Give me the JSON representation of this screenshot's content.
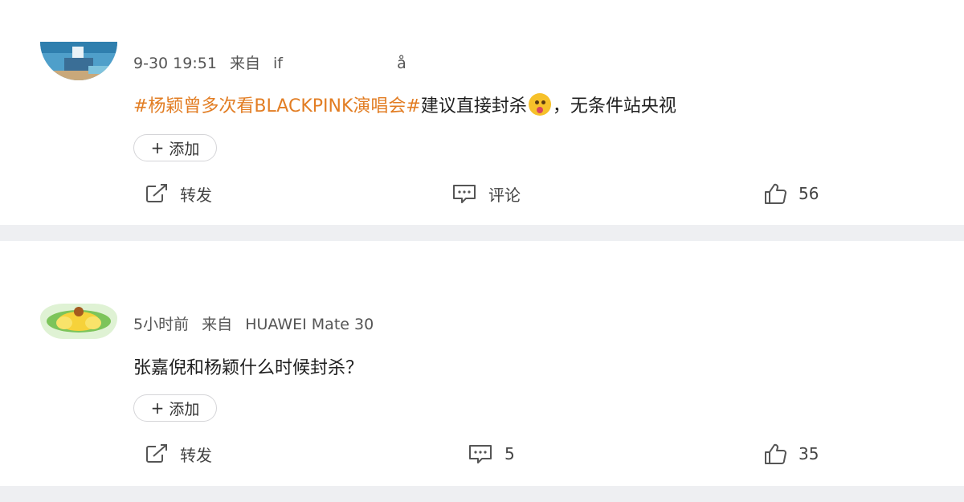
{
  "posts": [
    {
      "meta": {
        "time": "9-30 19:51",
        "source_prefix": "来自",
        "source": "if",
        "source_tail": "å"
      },
      "content": {
        "hashtag": "#杨颖曾多次看BLACKPINK演唱会#",
        "text_before_emoji": "建议直接封杀",
        "emoji": "drooling-face-emoji",
        "text_after_emoji": "，无条件站央视"
      },
      "add_button": {
        "icon": "plus-icon",
        "label": "添加"
      },
      "actions": {
        "repost": {
          "icon": "repost-icon",
          "label": "转发"
        },
        "comment": {
          "icon": "comment-icon",
          "label": "评论"
        },
        "like": {
          "icon": "thumbs-up-icon",
          "count": "56"
        }
      }
    },
    {
      "meta": {
        "time": "5小时前",
        "source_prefix": "来自",
        "source": "HUAWEI Mate 30"
      },
      "content": {
        "text": "张嘉倪和杨颖什么时候封杀？"
      },
      "add_button": {
        "icon": "plus-icon",
        "label": "添加"
      },
      "actions": {
        "repost": {
          "icon": "repost-icon",
          "label": "转发"
        },
        "comment": {
          "icon": "comment-icon",
          "count": "5"
        },
        "like": {
          "icon": "thumbs-up-icon",
          "count": "35"
        }
      }
    }
  ],
  "colors": {
    "hashtag": "#e27d23",
    "text": "#1f1f1f",
    "meta": "#555555",
    "separator": "#eeeff2"
  }
}
